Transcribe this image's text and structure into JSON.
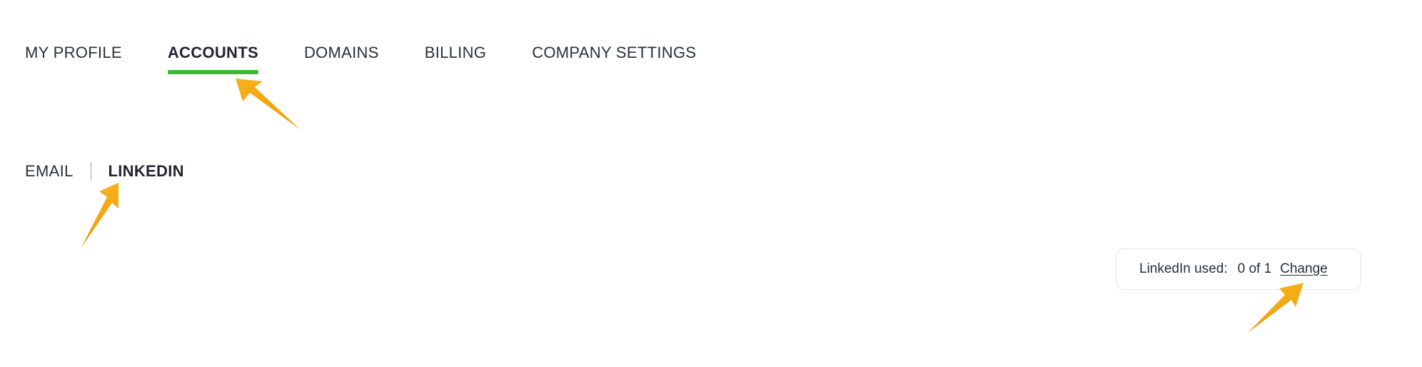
{
  "main_tabs": [
    {
      "label": "MY PROFILE",
      "active": false
    },
    {
      "label": "ACCOUNTS",
      "active": true
    },
    {
      "label": "DOMAINS",
      "active": false
    },
    {
      "label": "BILLING",
      "active": false
    },
    {
      "label": "COMPANY SETTINGS",
      "active": false
    }
  ],
  "sub_tabs": [
    {
      "label": "EMAIL",
      "active": false
    },
    {
      "label": "LINKEDIN",
      "active": true
    }
  ],
  "usage": {
    "label": "LinkedIn used:",
    "count": "0 of 1",
    "change_link": "Change"
  },
  "colors": {
    "active_tab_underline": "#3cb935",
    "annotation_arrow": "#f5a20c"
  }
}
